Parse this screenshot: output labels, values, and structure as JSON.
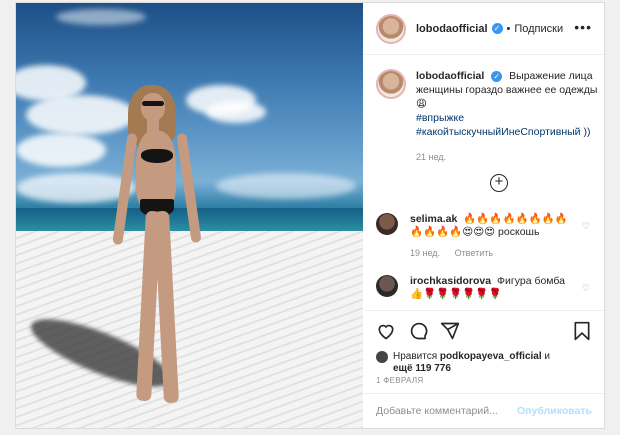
{
  "header": {
    "username": "lobodaofficial",
    "verified_mark": "✓",
    "separator": "•",
    "follow_label": "Подписки",
    "more_label": "•••"
  },
  "caption": {
    "username": "lobodaofficial",
    "text": "Выражение лица женщины гораздо важнее ее одежды😩",
    "tag1": "#впрыжке",
    "tag2": "#какойтыскучныйИнеСпортивный ))",
    "time": "21 нед."
  },
  "comments": [
    {
      "username": "selima.ak",
      "text": "🔥🔥🔥🔥🔥🔥🔥🔥🔥🔥🔥🔥😍😍😍 роскошь",
      "time": "19 нед.",
      "reply": "Ответить"
    },
    {
      "username": "irochkasidorova",
      "text": "Фигура бомба 👍🌹🌹🌹🌹🌹🌹"
    }
  ],
  "likes": {
    "prefix": "Нравится",
    "user": "podkopayeva_official",
    "suffix": "и",
    "count": "ещё 119 776"
  },
  "date": "1 ФЕВРАЛЯ",
  "comment_input": {
    "placeholder": "Добавьте комментарий...",
    "publish_label": "Опубликовать"
  },
  "icons": [
    "heart-icon",
    "comment-icon",
    "share-icon",
    "bookmark-icon",
    "plus-circle-icon",
    "more-icon",
    "verified-icon"
  ],
  "colors": {
    "link": "#00376b",
    "publish": "#b2dffc",
    "meta": "#8e8e8e",
    "verified": "#3897f0"
  }
}
